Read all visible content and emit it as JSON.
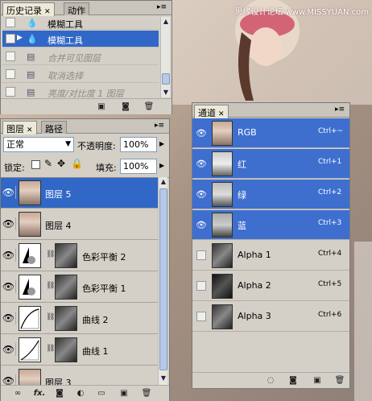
{
  "watermark": "思缘设计论坛 www.MISSYUAN.com",
  "history": {
    "tabs": [
      "历史记录",
      "动作"
    ],
    "items": [
      {
        "label": "模糊工具",
        "state": "done"
      },
      {
        "label": "模糊工具",
        "state": "selected"
      },
      {
        "label": "合并可见图层",
        "state": "undone"
      },
      {
        "label": "取消选择",
        "state": "undone"
      },
      {
        "label": "亮度/对比度 1 图层",
        "state": "undone"
      }
    ]
  },
  "layers": {
    "tabs": [
      "图层",
      "路径"
    ],
    "blend_mode": "正常",
    "opacity_label": "不透明度:",
    "opacity_value": "100%",
    "lock_label": "锁定:",
    "fill_label": "填充:",
    "fill_value": "100%",
    "items": [
      {
        "name": "图层 5",
        "type": "photo",
        "selected": true
      },
      {
        "name": "图层 4",
        "type": "photo",
        "selected": false
      },
      {
        "name": "色彩平衡 2",
        "type": "color-balance",
        "selected": false
      },
      {
        "name": "色彩平衡 1",
        "type": "color-balance",
        "selected": false
      },
      {
        "name": "曲线 2",
        "type": "curves",
        "selected": false
      },
      {
        "name": "曲线 1",
        "type": "curves",
        "selected": false
      },
      {
        "name": "图层 3",
        "type": "photo",
        "selected": false
      }
    ],
    "footer_fx": "fx."
  },
  "channels": {
    "tab": "通道",
    "items": [
      {
        "name": "RGB",
        "shortcut": "Ctrl+~",
        "visible": true
      },
      {
        "name": "红",
        "shortcut": "Ctrl+1",
        "visible": true
      },
      {
        "name": "绿",
        "shortcut": "Ctrl+2",
        "visible": true
      },
      {
        "name": "蓝",
        "shortcut": "Ctrl+3",
        "visible": true
      },
      {
        "name": "Alpha 1",
        "shortcut": "Ctrl+4",
        "visible": false
      },
      {
        "name": "Alpha 2",
        "shortcut": "Ctrl+5",
        "visible": false
      },
      {
        "name": "Alpha 3",
        "shortcut": "Ctrl+6",
        "visible": false
      }
    ]
  }
}
